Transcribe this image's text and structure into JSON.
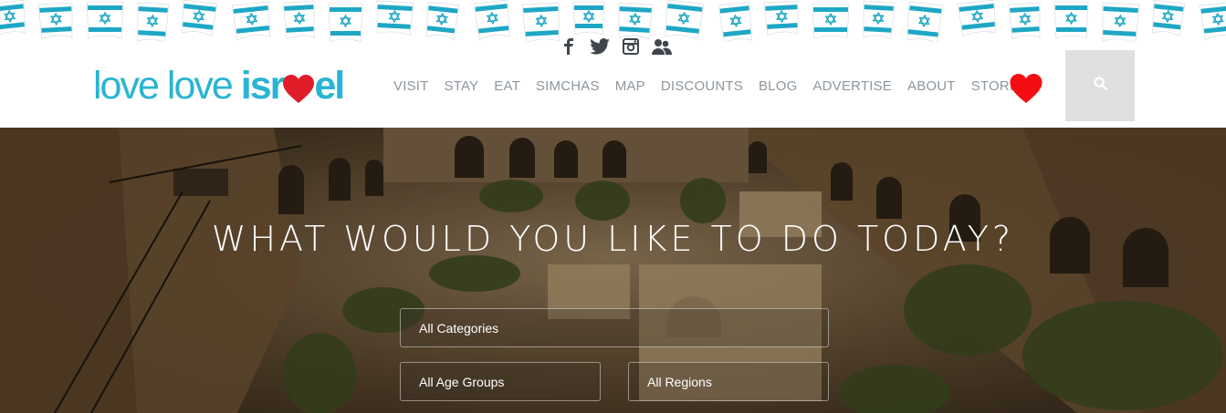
{
  "header": {
    "logo": {
      "part1": "love",
      "part2": "love",
      "part3a": "isr",
      "part3b": "el"
    },
    "social": [
      {
        "name": "facebook-icon"
      },
      {
        "name": "twitter-icon"
      },
      {
        "name": "instagram-icon"
      },
      {
        "name": "community-icon"
      }
    ],
    "nav": [
      {
        "label": "VISIT"
      },
      {
        "label": "STAY"
      },
      {
        "label": "EAT"
      },
      {
        "label": "SIMCHAS"
      },
      {
        "label": "MAP"
      },
      {
        "label": "DISCOUNTS"
      },
      {
        "label": "BLOG"
      },
      {
        "label": "ADVERTISE"
      },
      {
        "label": "ABOUT"
      },
      {
        "label": "STORE"
      }
    ]
  },
  "hero": {
    "title": "WHAT WOULD YOU LIKE TO DO TODAY?",
    "filters": {
      "category": "All Categories",
      "age_group": "All Age Groups",
      "region": "All Regions"
    }
  },
  "colors": {
    "brand": "#2ab4d2",
    "heart": "#e21d2a",
    "nav": "#8e969d",
    "search_bg": "#e2dfdf"
  }
}
